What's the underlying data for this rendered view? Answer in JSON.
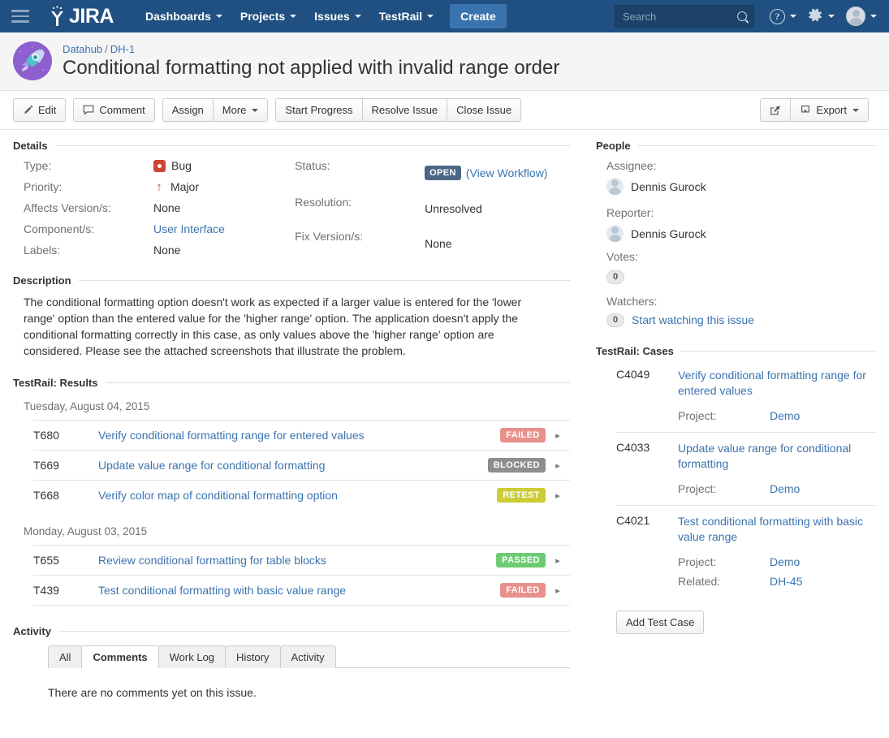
{
  "nav": {
    "brand": "JIRA",
    "items": [
      {
        "label": "Dashboards",
        "has_caret": true
      },
      {
        "label": "Projects",
        "has_caret": true
      },
      {
        "label": "Issues",
        "has_caret": true
      },
      {
        "label": "TestRail",
        "has_caret": true
      }
    ],
    "create_label": "Create",
    "search_placeholder": "Search",
    "search_value": ""
  },
  "issue": {
    "breadcrumb_project": "Datahub",
    "breadcrumb_key": "DH-1",
    "breadcrumb_separator": "/",
    "title": "Conditional formatting not applied with invalid range order"
  },
  "toolbar": {
    "edit": "Edit",
    "comment": "Comment",
    "assign": "Assign",
    "more": "More",
    "start_progress": "Start Progress",
    "resolve_issue": "Resolve Issue",
    "close_issue": "Close Issue",
    "export": "Export"
  },
  "details": {
    "heading": "Details",
    "left": [
      {
        "label": "Type:",
        "value": "Bug",
        "icon": "bug-icon"
      },
      {
        "label": "Priority:",
        "value": "Major",
        "icon": "priority-major-icon"
      },
      {
        "label": "Affects Version/s:",
        "value": "None"
      },
      {
        "label": "Component/s:",
        "value": "User Interface",
        "link": true
      },
      {
        "label": "Labels:",
        "value": "None"
      }
    ],
    "right": [
      {
        "label": "Status:",
        "value": "OPEN",
        "lozenge": true,
        "extra_link": "(View Workflow)"
      },
      {
        "label": "Resolution:",
        "value": "Unresolved"
      },
      {
        "label": "Fix Version/s:",
        "value": "None"
      }
    ]
  },
  "description": {
    "heading": "Description",
    "body": "The conditional formatting option doesn't work as expected if a larger value is entered for the 'lower range' option than the entered value for the 'higher range' option. The application doesn't apply the conditional formatting correctly in this case, as only values above the 'higher range' option are considered. Please see the attached screenshots that illustrate the problem."
  },
  "testrail_results": {
    "heading": "TestRail: Results",
    "groups": [
      {
        "date": "Tuesday, August 04, 2015",
        "rows": [
          {
            "id": "T680",
            "title": "Verify conditional formatting range for entered values",
            "status": "FAILED",
            "color": "#e8908a"
          },
          {
            "id": "T669",
            "title": "Update value range for conditional formatting",
            "status": "BLOCKED",
            "color": "#8e8e8e"
          },
          {
            "id": "T668",
            "title": "Verify color map of conditional formatting option",
            "status": "RETEST",
            "color": "#cccc34"
          }
        ]
      },
      {
        "date": "Monday, August 03, 2015",
        "rows": [
          {
            "id": "T655",
            "title": "Review conditional formatting for table blocks",
            "status": "PASSED",
            "color": "#6dcc73"
          },
          {
            "id": "T439",
            "title": "Test conditional formatting with basic value range",
            "status": "FAILED",
            "color": "#e8908a"
          }
        ]
      }
    ]
  },
  "activity": {
    "heading": "Activity",
    "tabs": [
      {
        "label": "All",
        "active": false
      },
      {
        "label": "Comments",
        "active": true
      },
      {
        "label": "Work Log",
        "active": false
      },
      {
        "label": "History",
        "active": false
      },
      {
        "label": "Activity",
        "active": false
      }
    ],
    "empty_message": "There are no comments yet on this issue."
  },
  "people": {
    "heading": "People",
    "assignee_label": "Assignee:",
    "assignee_name": "Dennis Gurock",
    "reporter_label": "Reporter:",
    "reporter_name": "Dennis Gurock",
    "votes_label": "Votes:",
    "votes_count": "0",
    "watchers_label": "Watchers:",
    "watchers_count": "0",
    "watch_link": "Start watching this issue"
  },
  "testrail_cases": {
    "heading": "TestRail: Cases",
    "cases": [
      {
        "id": "C4049",
        "title": "Verify conditional formatting range for entered values",
        "meta": [
          {
            "key": "Project:",
            "value": "Demo"
          }
        ]
      },
      {
        "id": "C4033",
        "title": "Update value range for conditional formatting",
        "meta": [
          {
            "key": "Project:",
            "value": "Demo"
          }
        ]
      },
      {
        "id": "C4021",
        "title": "Test conditional formatting with basic value range",
        "meta": [
          {
            "key": "Project:",
            "value": "Demo"
          },
          {
            "key": "Related:",
            "value": "DH-45"
          }
        ]
      }
    ],
    "add_button": "Add Test Case"
  },
  "colors": {
    "nav_blue": "#205081",
    "link_blue": "#3b73af",
    "create_blue": "#3b73af",
    "bug_red": "#d04437",
    "status_lozenge": "#4a6785",
    "project_avatar": "#8e5fce"
  }
}
